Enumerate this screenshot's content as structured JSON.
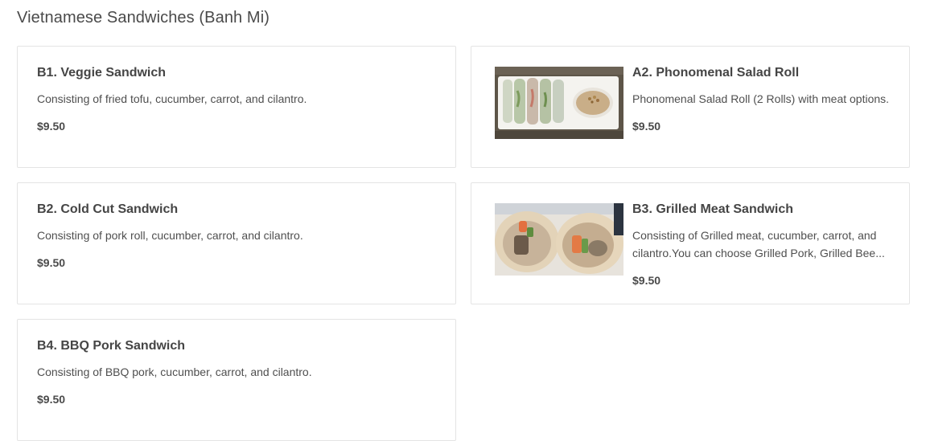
{
  "section": {
    "title": "Vietnamese Sandwiches (Banh Mi)"
  },
  "items": [
    {
      "name": "B1. Veggie Sandwich",
      "description": "Consisting of fried tofu, cucumber, carrot, and cilantro.",
      "price": "$9.50",
      "has_image": false
    },
    {
      "name": "A2. Phonomenal Salad Roll",
      "description": "Phonomenal Salad Roll (2 Rolls) with meat options.",
      "price": "$9.50",
      "has_image": true,
      "image": "salad-rolls-photo"
    },
    {
      "name": "B2. Cold Cut Sandwich",
      "description": "Consisting of pork roll, cucumber, carrot, and cilantro.",
      "price": "$9.50",
      "has_image": false
    },
    {
      "name": "B3. Grilled Meat Sandwich",
      "description": "Consisting of Grilled meat, cucumber, carrot, and cilantro.You can choose Grilled Pork, Grilled Bee...",
      "price": "$9.50",
      "has_image": true,
      "image": "banh-mi-photo"
    },
    {
      "name": "B4. BBQ Pork Sandwich",
      "description": "Consisting of BBQ pork, cucumber, carrot, and cilantro.",
      "price": "$9.50",
      "has_image": false
    }
  ]
}
